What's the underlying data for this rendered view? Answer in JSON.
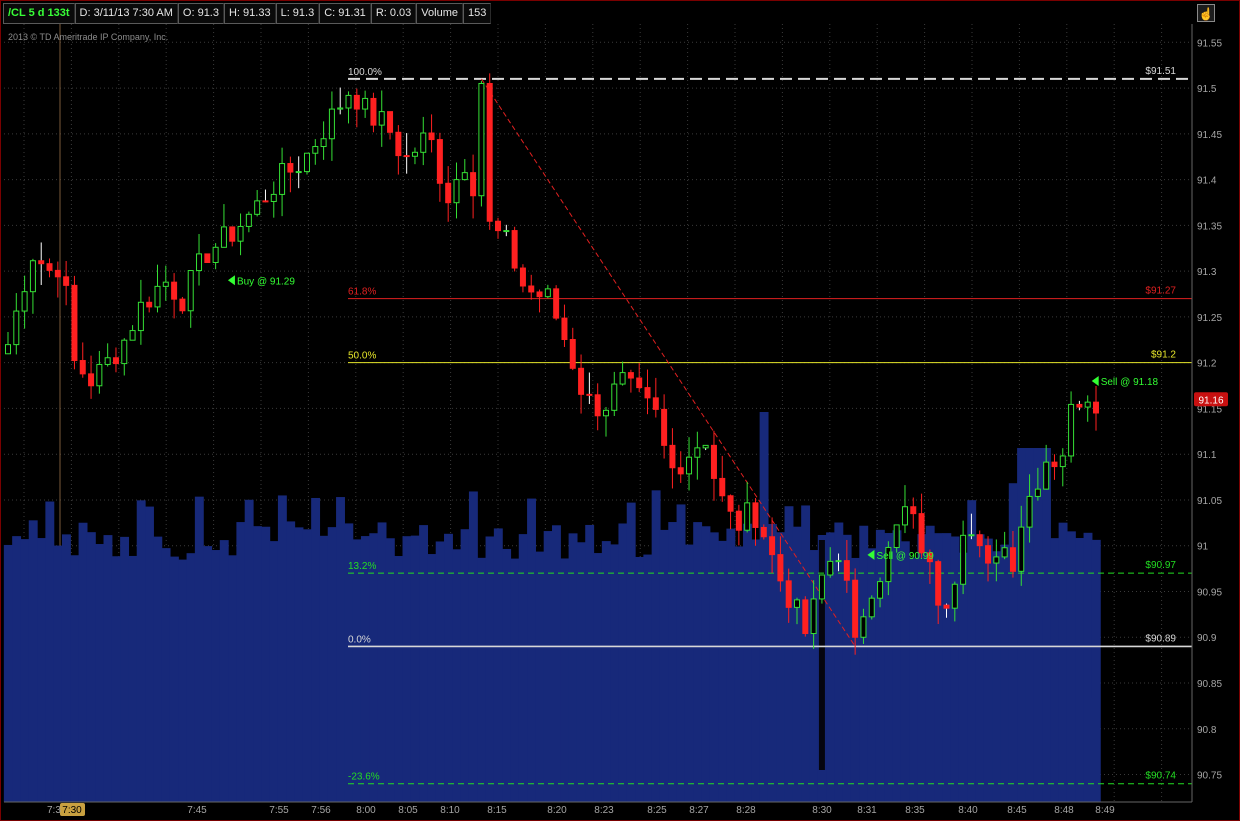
{
  "header": {
    "symbol": "/CL 5 d 133t",
    "date": "D: 3/11/13 7:30 AM",
    "open": "O: 91.3",
    "high": "H: 91.33",
    "low": "L: 91.3",
    "close": "C: 91.31",
    "range": "R: 0.03",
    "volume_label": "Volume",
    "volume_value": "153"
  },
  "copyright": "2013 © TD Ameritrade IP Company, Inc.",
  "colors": {
    "up": "#35e035",
    "down": "#ff2020",
    "volume": "#17297a",
    "volume_spike": "#05050f",
    "fib_white": "#d8d8d8",
    "fib_red": "#e02020",
    "fib_yellow": "#e6e62a",
    "fib_green": "#22dd22",
    "last_price_bg": "#c81010"
  },
  "last_price": "91.16",
  "chart_data": {
    "type": "candlestick",
    "y_axis": {
      "range": [
        90.72,
        91.57
      ],
      "ticks": [
        "91.55",
        "91.5",
        "91.45",
        "91.4",
        "91.35",
        "91.3",
        "91.25",
        "91.2",
        "91.15",
        "91.1",
        "91.05",
        "91",
        "90.95",
        "90.9",
        "90.85",
        "90.8",
        "90.75"
      ]
    },
    "x_ticks": [
      "7:30",
      "7:45",
      "7:55",
      "7:56",
      "8:00",
      "8:05",
      "8:10",
      "8:15",
      "8:20",
      "8:23",
      "8:25",
      "8:27",
      "8:28",
      "8:30",
      "8:31",
      "8:35",
      "8:40",
      "8:45",
      "8:48",
      "8:49"
    ],
    "highlighted_x_tick": "7:30",
    "first_x_tick_partial": "7:3",
    "candle_count": 132,
    "fibonacci": [
      {
        "pct": "100.0%",
        "price": 91.51,
        "label": "$91.51",
        "color_key": "fib_white",
        "dash": true
      },
      {
        "pct": "61.8%",
        "price": 91.27,
        "label": "$91.27",
        "color_key": "fib_red",
        "dash": false
      },
      {
        "pct": "50.0%",
        "price": 91.2,
        "label": "$91.2",
        "color_key": "fib_yellow",
        "dash": false
      },
      {
        "pct": "13.2%",
        "price": 90.97,
        "label": "$90.97",
        "color_key": "fib_green",
        "dash": true
      },
      {
        "pct": "0.0%",
        "price": 90.89,
        "label": "$90.89",
        "color_key": "fib_white",
        "dash": false
      },
      {
        "pct": "-23.6%",
        "price": 90.74,
        "label": "$90.74",
        "color_key": "fib_green",
        "dash": true
      }
    ],
    "fib_anchor_high": {
      "price": 91.51,
      "candle_index": 57
    },
    "fib_anchor_low": {
      "price": 90.89,
      "candle_index": 102
    },
    "orders": [
      {
        "label": "Buy @ 91.29",
        "price": 91.29,
        "candle_index": 26
      },
      {
        "label": "Sell @ 90.99",
        "price": 90.99,
        "candle_index": 103
      },
      {
        "label": "Sell @ 91.18",
        "price": 91.18,
        "candle_index": 130
      }
    ],
    "price_path": [
      [
        0,
        91.22
      ],
      [
        4,
        91.32
      ],
      [
        7,
        91.3
      ],
      [
        9,
        91.31
      ],
      [
        11,
        91.2
      ],
      [
        14,
        91.18
      ],
      [
        19,
        91.22
      ],
      [
        22,
        91.26
      ],
      [
        26,
        91.29
      ],
      [
        29,
        91.27
      ],
      [
        33,
        91.32
      ],
      [
        37,
        91.34
      ],
      [
        40,
        91.36
      ],
      [
        45,
        91.4
      ],
      [
        49,
        91.42
      ],
      [
        53,
        91.46
      ],
      [
        57,
        91.5
      ],
      [
        60,
        91.47
      ],
      [
        63,
        91.46
      ],
      [
        66,
        91.42
      ],
      [
        70,
        91.45
      ],
      [
        73,
        91.38
      ],
      [
        76,
        91.42
      ],
      [
        80,
        91.35
      ],
      [
        83,
        91.33
      ],
      [
        86,
        91.28
      ],
      [
        90,
        91.27
      ],
      [
        93,
        91.22
      ],
      [
        96,
        91.16
      ],
      [
        99,
        91.15
      ],
      [
        102,
        91.18
      ],
      [
        105,
        91.16
      ],
      [
        108,
        91.14
      ],
      [
        110,
        91.08
      ],
      [
        113,
        91.1
      ],
      [
        116,
        91.12
      ],
      [
        118,
        91.06
      ],
      [
        121,
        91.02
      ],
      [
        124,
        91.04
      ],
      [
        126,
        91.01
      ],
      [
        128,
        90.97
      ],
      [
        131,
        90.93
      ],
      [
        133,
        90.9
      ],
      [
        135,
        90.96
      ],
      [
        138,
        91.0
      ],
      [
        140,
        90.94
      ],
      [
        141,
        90.89
      ],
      [
        143,
        90.95
      ],
      [
        145,
        90.97
      ],
      [
        147,
        91.0
      ],
      [
        149,
        91.04
      ],
      [
        151,
        91.02
      ],
      [
        153,
        90.98
      ],
      [
        155,
        90.94
      ],
      [
        157,
        90.95
      ],
      [
        159,
        91.03
      ],
      [
        161,
        91.0
      ],
      [
        163,
        90.97
      ],
      [
        165,
        91.01
      ],
      [
        167,
        90.98
      ],
      [
        169,
        91.04
      ],
      [
        171,
        91.07
      ],
      [
        173,
        91.1
      ],
      [
        175,
        91.09
      ],
      [
        177,
        91.15
      ],
      [
        179,
        91.17
      ],
      [
        181,
        91.16
      ]
    ],
    "volume_spikes": [
      98
    ]
  }
}
